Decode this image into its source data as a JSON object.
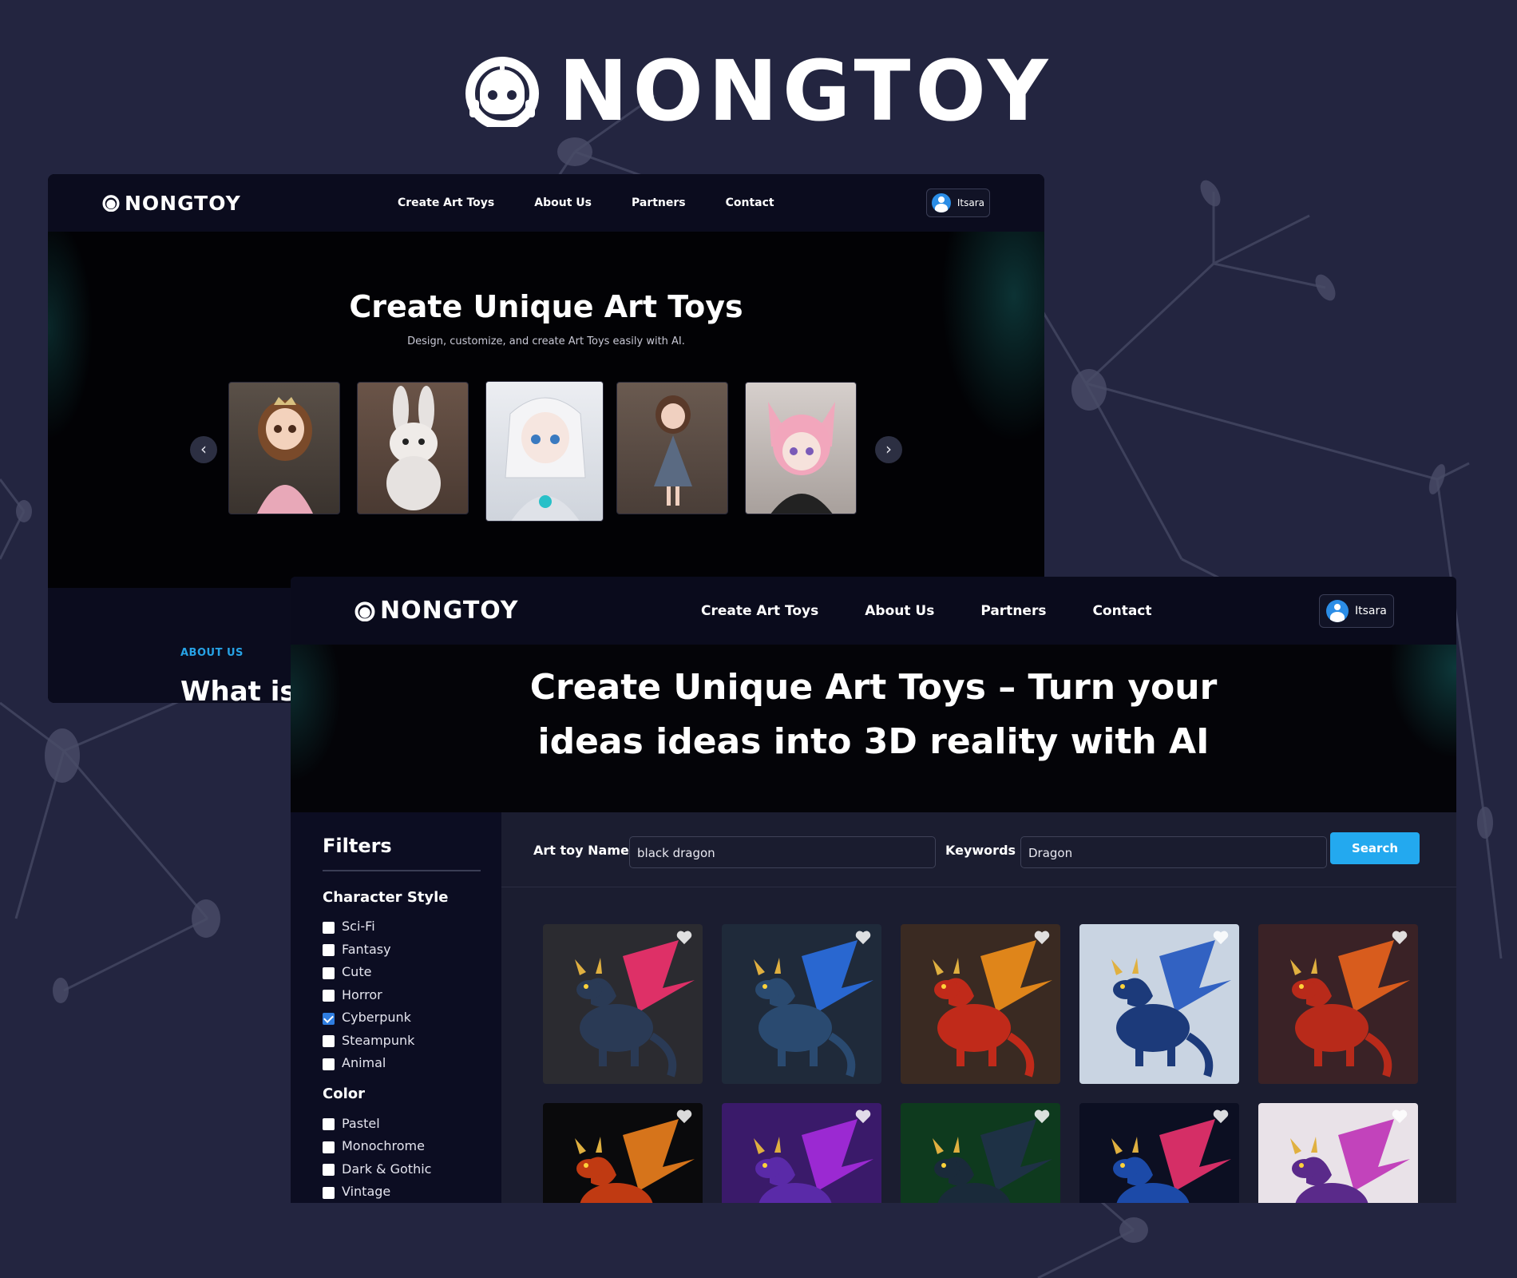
{
  "brand": {
    "name": "NONGTOY"
  },
  "window_top": {
    "nav": {
      "logo": "NONGTOY",
      "menu": [
        "Create Art Toys",
        "About Us",
        "Partners",
        "Contact"
      ],
      "user": "Itsara"
    },
    "hero": {
      "title": "Create Unique Art Toys",
      "subtitle": "Design, customize, and create Art Toys easily with AI.",
      "prev_arrow": "‹",
      "next_arrow": "›",
      "images": [
        "princess-doll",
        "bunny-toy",
        "robot-girl-figure",
        "girl-doll",
        "pink-hair-girl-figure"
      ]
    },
    "about": {
      "tag": "ABOUT US",
      "heading": "What is"
    }
  },
  "window_bottom": {
    "nav": {
      "logo": "NONGTOY",
      "menu": [
        "Create Art Toys",
        "About Us",
        "Partners",
        "Contact"
      ],
      "user": "Itsara"
    },
    "hero": {
      "title": "Create Unique Art Toys – Turn your ideas ideas into 3D reality with AI"
    },
    "filters": {
      "title": "Filters",
      "character_style": {
        "label": "Character Style",
        "options": [
          {
            "label": "Sci-Fi",
            "checked": false
          },
          {
            "label": "Fantasy",
            "checked": false
          },
          {
            "label": "Cute",
            "checked": false
          },
          {
            "label": "Horror",
            "checked": false
          },
          {
            "label": "Cyberpunk",
            "checked": true
          },
          {
            "label": "Steampunk",
            "checked": false
          },
          {
            "label": "Animal",
            "checked": false
          }
        ]
      },
      "color": {
        "label": "Color",
        "options": [
          {
            "label": "Pastel",
            "checked": false
          },
          {
            "label": "Monochrome",
            "checked": false
          },
          {
            "label": "Dark & Gothic",
            "checked": false
          },
          {
            "label": "Vintage",
            "checked": false
          }
        ]
      }
    },
    "search": {
      "name_label": "Art toy Name",
      "name_value": "black dragon",
      "keywords_label": "Keywords",
      "keywords_value": "Dragon",
      "button": "Search"
    },
    "results": [
      {
        "name": "dragon-red-teal",
        "bg": "#2b2b30",
        "body": "#2a3a55",
        "wing": "#e8306a"
      },
      {
        "name": "dragon-neon-blue",
        "bg": "#1f2a3a",
        "body": "#2a4a70",
        "wing": "#2a6ad8"
      },
      {
        "name": "dragon-red-gold",
        "bg": "#3a2a22",
        "body": "#c02a1a",
        "wing": "#e88a1a"
      },
      {
        "name": "dragon-blue-white",
        "bg": "#c9d4e2",
        "body": "#1c3a7a",
        "wing": "#2a5cc0"
      },
      {
        "name": "dragon-orange-red",
        "bg": "#3a2226",
        "body": "#b82a1a",
        "wing": "#e0601c"
      },
      {
        "name": "dragon-orange-black",
        "bg": "#0a0a0c",
        "body": "#c03a12",
        "wing": "#e27a1c"
      },
      {
        "name": "dragon-purple-neon",
        "bg": "#3a1a6a",
        "body": "#5a2aa8",
        "wing": "#a02ad8"
      },
      {
        "name": "dragon-green-neon",
        "bg": "#0e3a1e",
        "body": "#1a2a3a",
        "wing": "#203048"
      },
      {
        "name": "dragon-blue-pink",
        "bg": "#0c0f22",
        "body": "#1c4aa8",
        "wing": "#e0306a"
      },
      {
        "name": "dragon-purple-pink",
        "bg": "#e9e2e8",
        "body": "#5a2a8a",
        "wing": "#c03ab8"
      }
    ]
  }
}
